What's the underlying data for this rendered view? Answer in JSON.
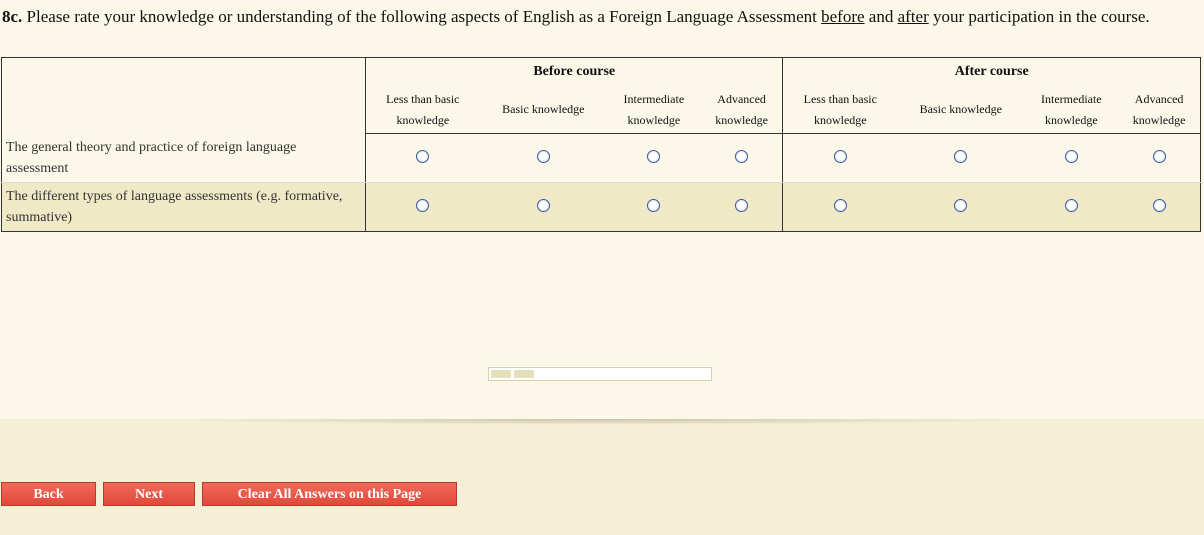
{
  "question": {
    "number": "8c.",
    "text_before": " Please rate your knowledge or understanding of the following aspects of English as a Foreign Language Assessment ",
    "emph_before": "before",
    "text_and": " and ",
    "emph_after": "after",
    "text_end": " your participation in the course."
  },
  "grid": {
    "groups": [
      "Before course",
      "After course"
    ],
    "columns": [
      {
        "line1": "Less than basic",
        "line2": "knowledge"
      },
      {
        "line1": "Basic knowledge",
        "line2": ""
      },
      {
        "line1": "Intermediate",
        "line2": "knowledge"
      },
      {
        "line1": "Advanced",
        "line2": "knowledge"
      }
    ],
    "rows": [
      {
        "label_line1": "The general theory and practice of foreign language",
        "label_line2": "assessment"
      },
      {
        "label_line1": "The different types of language assessments (e.g. formative,",
        "label_line2": "summative)"
      }
    ]
  },
  "progress": {
    "value": 0.2
  },
  "buttons": {
    "back": "Back",
    "next": "Next",
    "clear": "Clear All Answers on this Page"
  },
  "colors": {
    "button": "#e65445",
    "alt_row": "#f0e9c7",
    "background": "#fbf8ea",
    "radio_border": "#3a5a98"
  }
}
